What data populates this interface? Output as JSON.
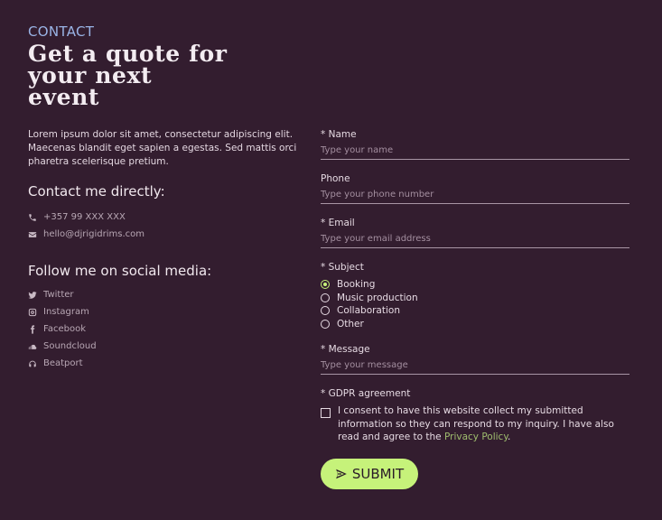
{
  "left": {
    "eyebrow": "CONTACT",
    "headline": [
      "Get a quote for",
      "your next",
      "event"
    ],
    "intro": "Lorem ipsum dolor sit amet, consectetur adipiscing elit. Maecenas blandit eget sapien a egestas. Sed mattis orci pharetra scelerisque pretium.",
    "contact_heading": "Contact me directly:",
    "contacts": [
      {
        "icon": "phone-icon",
        "text": "+357 99 XXX XXX"
      },
      {
        "icon": "mail-icon",
        "text": "hello@djrigidrims.com"
      }
    ],
    "social_heading": "Follow me on social media:",
    "socials": [
      {
        "icon": "twitter-icon",
        "text": "Twitter"
      },
      {
        "icon": "instagram-icon",
        "text": "Instagram"
      },
      {
        "icon": "facebook-icon",
        "text": "Facebook"
      },
      {
        "icon": "soundcloud-icon",
        "text": "Soundcloud"
      },
      {
        "icon": "beatport-icon",
        "text": "Beatport"
      }
    ]
  },
  "form": {
    "name_label": "* Name",
    "name_placeholder": "Type your name",
    "phone_label": "Phone",
    "phone_placeholder": "Type your phone number",
    "email_label": "* Email",
    "email_placeholder": "Type your email address",
    "subject_label": "* Subject",
    "subjects": [
      "Booking",
      "Music production",
      "Collaboration",
      "Other"
    ],
    "selected_subject": "Booking",
    "message_label": "* Message",
    "message_placeholder": "Type your message",
    "gdpr_label": "* GDPR agreement",
    "gdpr_text": "I consent to have this website collect my submitted information so they can respond to my inquiry. I have also read and agree to the",
    "privacy_link": "Privacy Policy",
    "period": ".",
    "submit_label": "SUBMIT"
  },
  "colors": {
    "background": "#331d2f",
    "accent": "#c6f27a",
    "eyebrow": "#9ab4e6",
    "link": "#9fbd6e"
  }
}
